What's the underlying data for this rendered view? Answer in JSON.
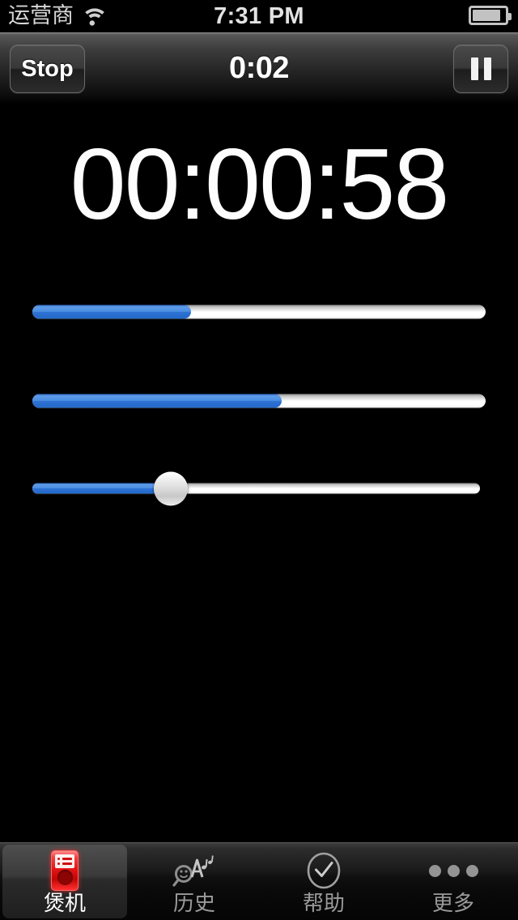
{
  "status_bar": {
    "carrier": "运营商",
    "wifi_icon": "wifi-icon",
    "time": "7:31 PM",
    "battery_icon": "battery-icon",
    "battery_level_pct": 88
  },
  "nav_bar": {
    "stop_label": "Stop",
    "title": "0:02",
    "pause_icon": "pause-icon"
  },
  "main": {
    "elapsed_timer": "00:00:58",
    "sliders": [
      {
        "name": "slider-one",
        "value_pct": 35,
        "has_thumb": false
      },
      {
        "name": "slider-two",
        "value_pct": 55,
        "has_thumb": false
      },
      {
        "name": "slider-three",
        "value_pct": 31,
        "has_thumb": true
      }
    ]
  },
  "tab_bar": {
    "tabs": [
      {
        "label": "煲机",
        "icon": "ipod-device-icon",
        "active": true
      },
      {
        "label": "历史",
        "icon": "magnifier-music-icon",
        "active": false
      },
      {
        "label": "帮助",
        "icon": "check-circle-icon",
        "active": false
      },
      {
        "label": "更多",
        "icon": "more-dots-icon",
        "active": false
      }
    ]
  },
  "colors": {
    "accent_blue": "#3d82dd",
    "active_red": "#e01414",
    "background": "#000000",
    "track_white": "#ffffff",
    "label_gray": "#9a9a9a"
  }
}
